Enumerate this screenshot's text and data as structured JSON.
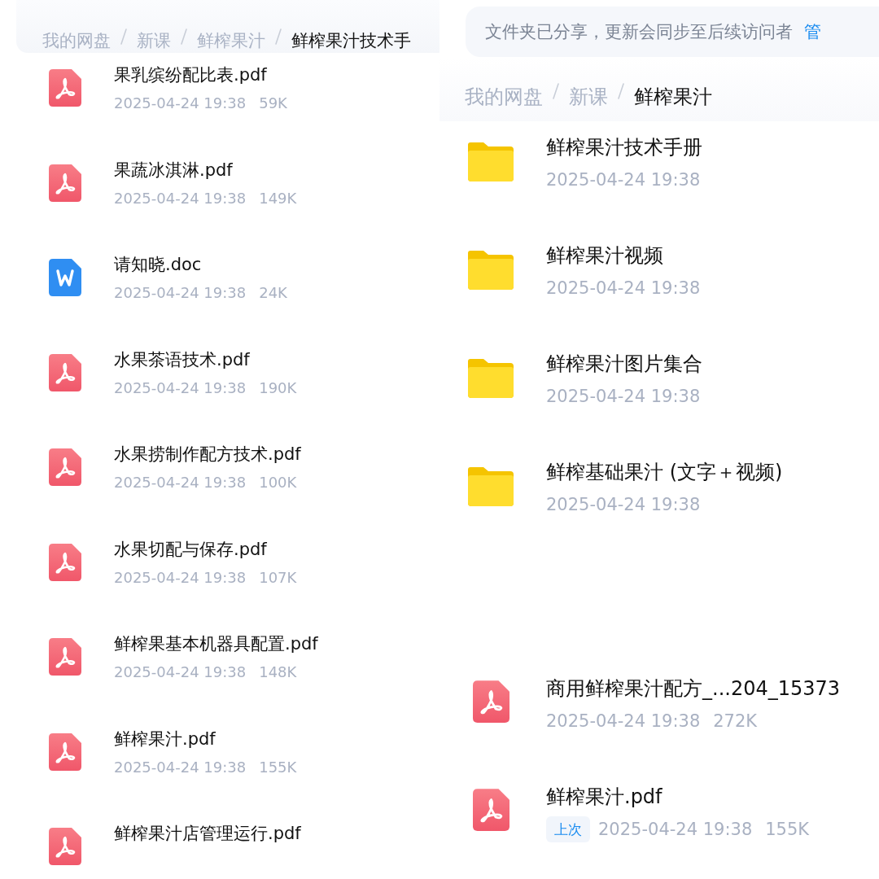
{
  "panels": [
    {
      "breadcrumb": [
        {
          "label": "我的网盘",
          "current": false
        },
        {
          "label": "新课",
          "current": false
        },
        {
          "label": "鲜榨果汁",
          "current": false
        },
        {
          "label": "鲜榨果汁技术手",
          "current": true
        }
      ],
      "files": [
        {
          "kind": "pdf",
          "name": "果乳缤纷配比表.pdf",
          "date": "2025-04-24 19:38",
          "size": "59K"
        },
        {
          "kind": "pdf",
          "name": "果蔬冰淇淋.pdf",
          "date": "2025-04-24 19:38",
          "size": "149K"
        },
        {
          "kind": "doc",
          "name": "请知晓.doc",
          "date": "2025-04-24 19:38",
          "size": "24K"
        },
        {
          "kind": "pdf",
          "name": "水果茶语技术.pdf",
          "date": "2025-04-24 19:38",
          "size": "190K"
        },
        {
          "kind": "pdf",
          "name": "水果捞制作配方技术.pdf",
          "date": "2025-04-24 19:38",
          "size": "100K"
        },
        {
          "kind": "pdf",
          "name": "水果切配与保存.pdf",
          "date": "2025-04-24 19:38",
          "size": "107K"
        },
        {
          "kind": "pdf",
          "name": "鲜榨果基本机器具配置.pdf",
          "date": "2025-04-24 19:38",
          "size": "148K"
        },
        {
          "kind": "pdf",
          "name": "鲜榨果汁.pdf",
          "date": "2025-04-24 19:38",
          "size": "155K"
        },
        {
          "kind": "pdf",
          "name": "鲜榨果汁店管理运行.pdf"
        }
      ]
    },
    {
      "notice": {
        "text": "文件夹已分享，更新会同步至后续访问者",
        "action": "管"
      },
      "breadcrumb": [
        {
          "label": "我的网盘",
          "current": false
        },
        {
          "label": "新课",
          "current": false
        },
        {
          "label": "鲜榨果汁",
          "current": true
        }
      ],
      "files": [
        {
          "kind": "folder",
          "name": "鲜榨果汁技术手册",
          "date": "2025-04-24 19:38"
        },
        {
          "kind": "folder",
          "name": "鲜榨果汁视频",
          "date": "2025-04-24 19:38"
        },
        {
          "kind": "folder",
          "name": "鲜榨果汁图片集合",
          "date": "2025-04-24 19:38"
        },
        {
          "kind": "folder",
          "name": "鲜榨基础果汁 (文字＋视频)",
          "date": "2025-04-24 19:38"
        },
        {
          "kind": "pdf",
          "name": "商用鲜榨果汁配方_...204_15373",
          "date": "2025-04-24 19:38",
          "size": "272K"
        },
        {
          "kind": "pdf",
          "name": "鲜榨果汁.pdf",
          "tag": "上次",
          "date": "2025-04-24 19:38",
          "size": "155K"
        }
      ]
    }
  ]
}
